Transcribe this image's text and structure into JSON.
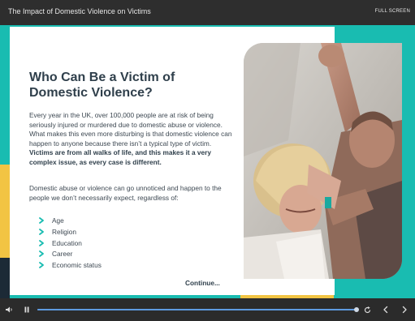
{
  "header": {
    "title": "The Impact of Domestic Violence on Victims",
    "fullscreen_label": "FULL SCREEN"
  },
  "slide": {
    "heading": "Who Can Be a Victim of Domestic Violence?",
    "para1_plain": "Every year in the UK, over 100,000 people are at risk of being seriously injured or murdered due to domestic abuse or violence. What makes this even more disturbing is that domestic violence can happen to anyone because there isn’t a typical type of victim.",
    "para1_bold": "Victims are from all walks of life, and this makes it a very complex issue, as every case is different.",
    "para2": "Domestic abuse or violence can go unnoticed and happen to the people we don’t necessarily expect, regardless of:",
    "list": [
      "Age",
      "Religion",
      "Education",
      "Career",
      "Economic status"
    ],
    "continue_label": "Continue...",
    "photo_icon": "domestic-violence-photo"
  },
  "player": {
    "progress": 1.0,
    "icons": [
      "volume-icon",
      "pause-icon",
      "replay-icon",
      "previous-icon",
      "next-icon"
    ]
  },
  "colors": {
    "teal": "#19bcb1",
    "yellow": "#f2c443",
    "heading": "#2f3f4b",
    "chevron": "#19bcb1"
  }
}
